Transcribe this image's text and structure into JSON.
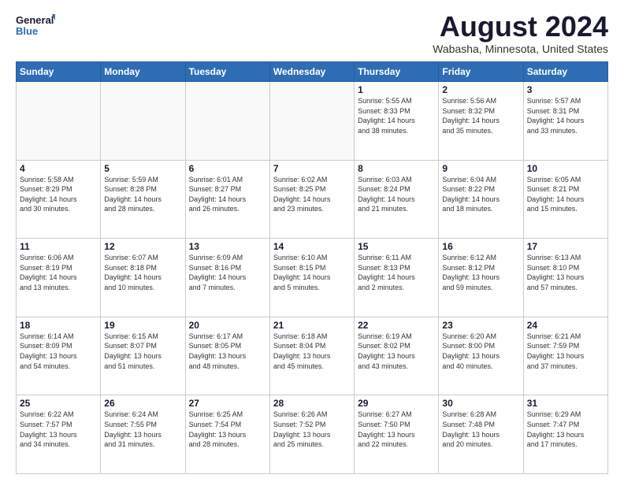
{
  "header": {
    "logo_line1": "General",
    "logo_line2": "Blue",
    "month_year": "August 2024",
    "location": "Wabasha, Minnesota, United States"
  },
  "days_of_week": [
    "Sunday",
    "Monday",
    "Tuesday",
    "Wednesday",
    "Thursday",
    "Friday",
    "Saturday"
  ],
  "weeks": [
    [
      {
        "day": "",
        "info": ""
      },
      {
        "day": "",
        "info": ""
      },
      {
        "day": "",
        "info": ""
      },
      {
        "day": "",
        "info": ""
      },
      {
        "day": "1",
        "info": "Sunrise: 5:55 AM\nSunset: 8:33 PM\nDaylight: 14 hours\nand 38 minutes."
      },
      {
        "day": "2",
        "info": "Sunrise: 5:56 AM\nSunset: 8:32 PM\nDaylight: 14 hours\nand 35 minutes."
      },
      {
        "day": "3",
        "info": "Sunrise: 5:57 AM\nSunset: 8:31 PM\nDaylight: 14 hours\nand 33 minutes."
      }
    ],
    [
      {
        "day": "4",
        "info": "Sunrise: 5:58 AM\nSunset: 8:29 PM\nDaylight: 14 hours\nand 30 minutes."
      },
      {
        "day": "5",
        "info": "Sunrise: 5:59 AM\nSunset: 8:28 PM\nDaylight: 14 hours\nand 28 minutes."
      },
      {
        "day": "6",
        "info": "Sunrise: 6:01 AM\nSunset: 8:27 PM\nDaylight: 14 hours\nand 26 minutes."
      },
      {
        "day": "7",
        "info": "Sunrise: 6:02 AM\nSunset: 8:25 PM\nDaylight: 14 hours\nand 23 minutes."
      },
      {
        "day": "8",
        "info": "Sunrise: 6:03 AM\nSunset: 8:24 PM\nDaylight: 14 hours\nand 21 minutes."
      },
      {
        "day": "9",
        "info": "Sunrise: 6:04 AM\nSunset: 8:22 PM\nDaylight: 14 hours\nand 18 minutes."
      },
      {
        "day": "10",
        "info": "Sunrise: 6:05 AM\nSunset: 8:21 PM\nDaylight: 14 hours\nand 15 minutes."
      }
    ],
    [
      {
        "day": "11",
        "info": "Sunrise: 6:06 AM\nSunset: 8:19 PM\nDaylight: 14 hours\nand 13 minutes."
      },
      {
        "day": "12",
        "info": "Sunrise: 6:07 AM\nSunset: 8:18 PM\nDaylight: 14 hours\nand 10 minutes."
      },
      {
        "day": "13",
        "info": "Sunrise: 6:09 AM\nSunset: 8:16 PM\nDaylight: 14 hours\nand 7 minutes."
      },
      {
        "day": "14",
        "info": "Sunrise: 6:10 AM\nSunset: 8:15 PM\nDaylight: 14 hours\nand 5 minutes."
      },
      {
        "day": "15",
        "info": "Sunrise: 6:11 AM\nSunset: 8:13 PM\nDaylight: 14 hours\nand 2 minutes."
      },
      {
        "day": "16",
        "info": "Sunrise: 6:12 AM\nSunset: 8:12 PM\nDaylight: 13 hours\nand 59 minutes."
      },
      {
        "day": "17",
        "info": "Sunrise: 6:13 AM\nSunset: 8:10 PM\nDaylight: 13 hours\nand 57 minutes."
      }
    ],
    [
      {
        "day": "18",
        "info": "Sunrise: 6:14 AM\nSunset: 8:09 PM\nDaylight: 13 hours\nand 54 minutes."
      },
      {
        "day": "19",
        "info": "Sunrise: 6:15 AM\nSunset: 8:07 PM\nDaylight: 13 hours\nand 51 minutes."
      },
      {
        "day": "20",
        "info": "Sunrise: 6:17 AM\nSunset: 8:05 PM\nDaylight: 13 hours\nand 48 minutes."
      },
      {
        "day": "21",
        "info": "Sunrise: 6:18 AM\nSunset: 8:04 PM\nDaylight: 13 hours\nand 45 minutes."
      },
      {
        "day": "22",
        "info": "Sunrise: 6:19 AM\nSunset: 8:02 PM\nDaylight: 13 hours\nand 43 minutes."
      },
      {
        "day": "23",
        "info": "Sunrise: 6:20 AM\nSunset: 8:00 PM\nDaylight: 13 hours\nand 40 minutes."
      },
      {
        "day": "24",
        "info": "Sunrise: 6:21 AM\nSunset: 7:59 PM\nDaylight: 13 hours\nand 37 minutes."
      }
    ],
    [
      {
        "day": "25",
        "info": "Sunrise: 6:22 AM\nSunset: 7:57 PM\nDaylight: 13 hours\nand 34 minutes."
      },
      {
        "day": "26",
        "info": "Sunrise: 6:24 AM\nSunset: 7:55 PM\nDaylight: 13 hours\nand 31 minutes."
      },
      {
        "day": "27",
        "info": "Sunrise: 6:25 AM\nSunset: 7:54 PM\nDaylight: 13 hours\nand 28 minutes."
      },
      {
        "day": "28",
        "info": "Sunrise: 6:26 AM\nSunset: 7:52 PM\nDaylight: 13 hours\nand 25 minutes."
      },
      {
        "day": "29",
        "info": "Sunrise: 6:27 AM\nSunset: 7:50 PM\nDaylight: 13 hours\nand 22 minutes."
      },
      {
        "day": "30",
        "info": "Sunrise: 6:28 AM\nSunset: 7:48 PM\nDaylight: 13 hours\nand 20 minutes."
      },
      {
        "day": "31",
        "info": "Sunrise: 6:29 AM\nSunset: 7:47 PM\nDaylight: 13 hours\nand 17 minutes."
      }
    ]
  ]
}
